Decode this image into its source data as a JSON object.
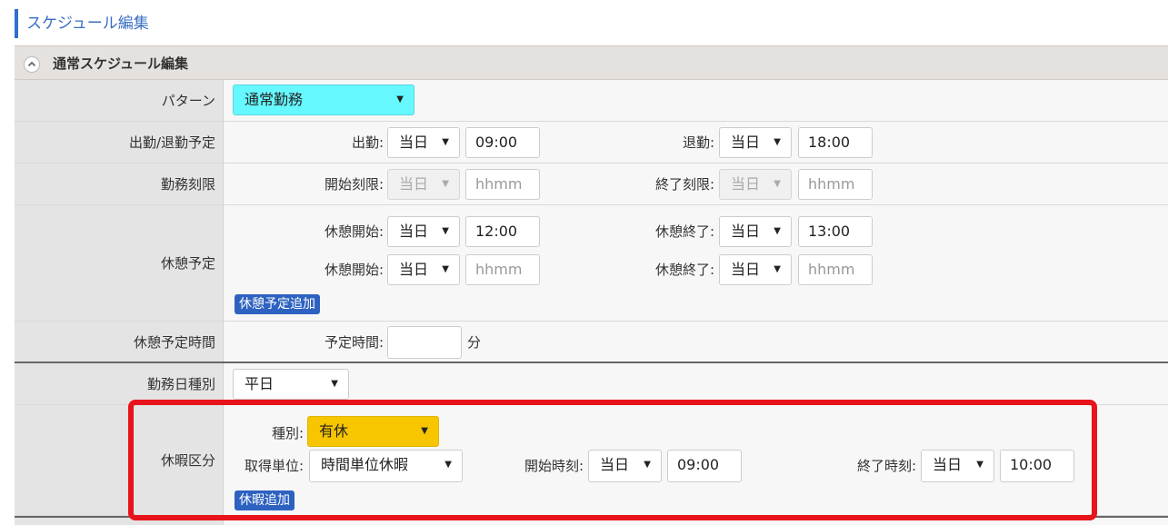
{
  "page_title": "スケジュール編集",
  "section": {
    "title": "通常スケジュール編集",
    "icon": "chevron-up-icon"
  },
  "rows": {
    "pattern": {
      "label": "パターン",
      "value": "通常勤務",
      "bg": "#66f8ff"
    },
    "attendance": {
      "label": "出勤/退勤予定",
      "start_label": "出勤:",
      "start_day": "当日",
      "start_time": "09:00",
      "end_label": "退勤:",
      "end_day": "当日",
      "end_time": "18:00"
    },
    "limit": {
      "label": "勤務刻限",
      "start_label": "開始刻限:",
      "start_day": "当日",
      "start_placeholder": "hhmm",
      "end_label": "終了刻限:",
      "end_day": "当日",
      "end_placeholder": "hhmm"
    },
    "break": {
      "label": "休憩予定",
      "entries": [
        {
          "start_label": "休憩開始:",
          "start_day": "当日",
          "start_time": "12:00",
          "end_label": "休憩終了:",
          "end_day": "当日",
          "end_time": "13:00"
        },
        {
          "start_label": "休憩開始:",
          "start_day": "当日",
          "start_placeholder": "hhmm",
          "end_label": "休憩終了:",
          "end_day": "当日",
          "end_placeholder": "hhmm"
        }
      ],
      "add_button": "休憩予定追加"
    },
    "break_time": {
      "label": "休憩予定時間",
      "field_label": "予定時間:",
      "unit": "分",
      "value": ""
    },
    "day_type": {
      "label": "勤務日種別",
      "value": "平日"
    },
    "leave": {
      "label": "休暇区分",
      "type_label": "種別:",
      "type_value": "有休",
      "type_bg": "#f7c600",
      "unit_label": "取得単位:",
      "unit_value": "時間単位休暇",
      "start_label": "開始時刻:",
      "start_day": "当日",
      "start_time": "09:00",
      "end_label": "終了時刻:",
      "end_day": "当日",
      "end_time": "10:00",
      "add_button": "休暇追加"
    }
  },
  "colors": {
    "accent": "#2e62c0",
    "highlight": "#e8141b"
  }
}
